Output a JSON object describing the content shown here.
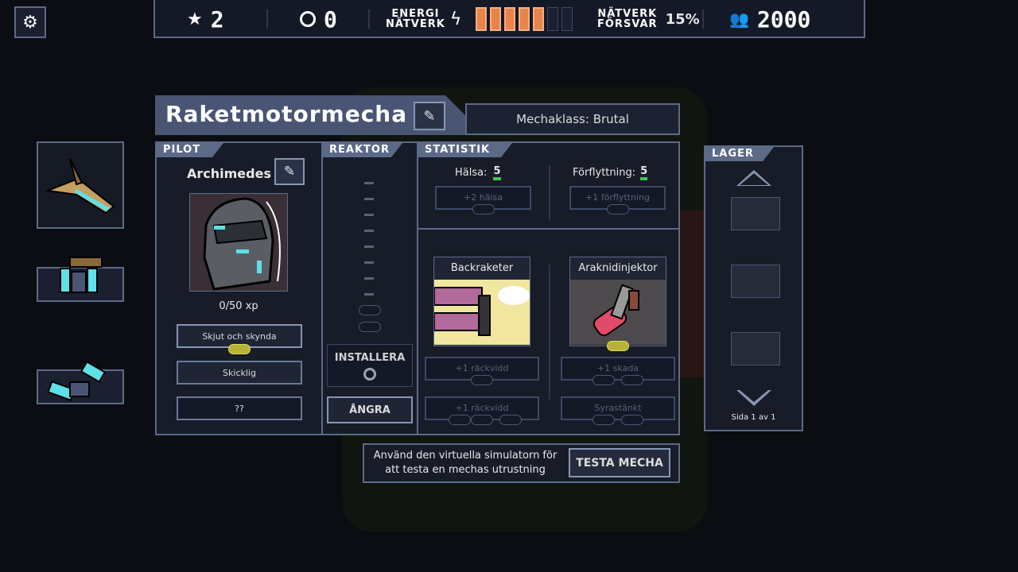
{
  "top_bar": {
    "stars": "2",
    "reputation": "0",
    "energy_label_1": "ENERGI",
    "energy_label_2": "NÄTVERK",
    "energy_filled": 5,
    "energy_total": 7,
    "defense_label_1": "NÄTVERK",
    "defense_label_2": "FÖRSVAR",
    "defense_value": "15%",
    "population": "2000"
  },
  "mech": {
    "name": "Raketmotormecha",
    "class_label": "Mechaklass: Brutal"
  },
  "pilot": {
    "tag": "PILOT",
    "name": "Archimedes",
    "xp": "0/50 xp",
    "skill_1": "Skjut och skynda",
    "skill_2": "Skicklig",
    "skill_3": "??"
  },
  "reactor": {
    "tag": "REAKTOR",
    "install_label": "INSTALLERA",
    "undo_label": "ÅNGRA"
  },
  "stats": {
    "tag": "STATISTIK",
    "health_label": "Hälsa:",
    "health_value": "5",
    "health_upgrade": "+2 hälsa",
    "move_label": "Förflyttning:",
    "move_value": "5",
    "move_upgrade": "+1 förflyttning"
  },
  "weapons": [
    {
      "name": "Backraketer",
      "upgrade_1": "+1 räckvidd",
      "upgrade_2": "+1 räckvidd"
    },
    {
      "name": "Araknidinjektor",
      "upgrade_1": "+1 skada",
      "upgrade_2": "Syrastänkt"
    }
  ],
  "storage": {
    "tag": "LAGER",
    "page": "Sida 1 av 1"
  },
  "simulator": {
    "text_1": "Använd den virtuella simulatorn för",
    "text_2": "att testa en mechas utrustning",
    "button": "TESTA MECHA"
  },
  "colors": {
    "panel_border": "#5c6a88",
    "energy_on": "#e8834a",
    "energy_off": "#1a2030",
    "accent_cyan": "#5fe0e8"
  }
}
